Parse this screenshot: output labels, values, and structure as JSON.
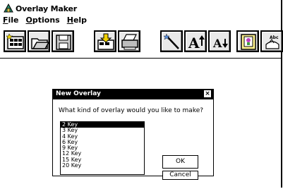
{
  "app": {
    "title": "Overlay Maker"
  },
  "menus": [
    {
      "label": "File",
      "underline": "F",
      "rest": "ile"
    },
    {
      "label": "Options",
      "underline": "O",
      "rest": "ptions"
    },
    {
      "label": "Help",
      "underline": "H",
      "rest": "elp"
    }
  ],
  "toolbar": {
    "buttons": [
      {
        "name": "new-overlay-icon"
      },
      {
        "name": "open-folder-icon"
      },
      {
        "name": "save-disk-icon"
      },
      {
        "name": "download-icon"
      },
      {
        "name": "print-icon"
      },
      {
        "name": "magic-wand-icon"
      },
      {
        "name": "text-size-up-icon",
        "glyph": "A",
        "arrow": "↑"
      },
      {
        "name": "text-size-down-icon",
        "glyph": "A",
        "arrow": "↓"
      },
      {
        "name": "picture-frame-icon"
      },
      {
        "name": "text-label-icon",
        "glyph": "Abc"
      }
    ]
  },
  "dialog": {
    "title": "New Overlay",
    "close_glyph": "×",
    "prompt": "What kind of overlay would you like to make?",
    "options": [
      "2 Key",
      "3 Key",
      "4 Key",
      "6 Key",
      "9 Key",
      "12 Key",
      "15 Key",
      "20 Key"
    ],
    "selected_index": 0,
    "ok_label": "OK",
    "cancel_label": "Cancel"
  }
}
